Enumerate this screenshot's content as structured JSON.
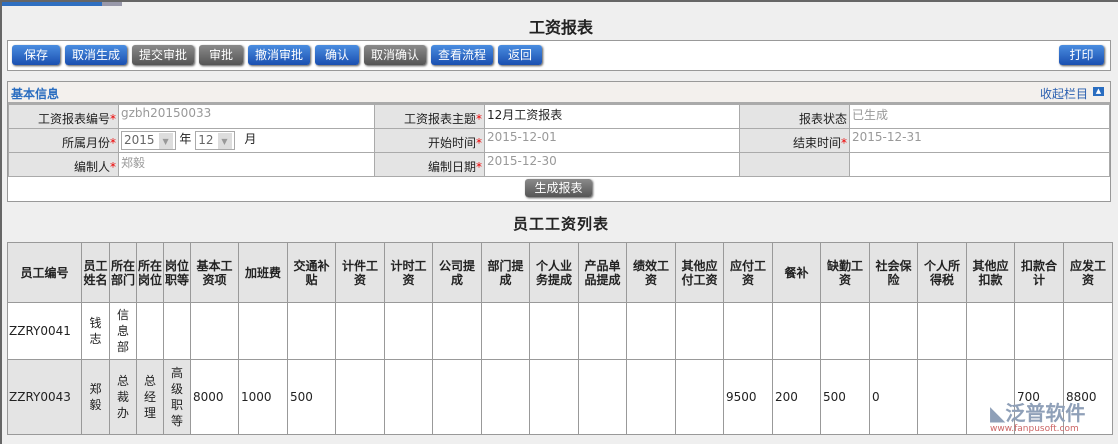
{
  "title": "工资报表",
  "toolbar": {
    "buttons": [
      {
        "label": "保存",
        "style": "blue"
      },
      {
        "label": "取消生成",
        "style": "blue"
      },
      {
        "label": "提交审批",
        "style": "gray"
      },
      {
        "label": "审批",
        "style": "gray"
      },
      {
        "label": "撤消审批",
        "style": "blue"
      },
      {
        "label": "确认",
        "style": "blue"
      },
      {
        "label": "取消确认",
        "style": "gray"
      },
      {
        "label": "查看流程",
        "style": "blue"
      },
      {
        "label": "返回",
        "style": "blue"
      }
    ],
    "print": "打印"
  },
  "basic": {
    "title": "基本信息",
    "collapse": "收起栏目",
    "report_no_label": "工资报表编号",
    "report_no": "gzbh20150033",
    "subject_label": "工资报表主题",
    "subject": "12月工资报表",
    "status_label": "报表状态",
    "status": "已生成",
    "month_label": "所属月份",
    "year": "2015",
    "year_unit": "年",
    "month": "12",
    "month_unit": "月",
    "start_label": "开始时间",
    "start": "2015-12-01",
    "end_label": "结束时间",
    "end": "2015-12-31",
    "author_label": "编制人",
    "author": "郑毅",
    "date_label": "编制日期",
    "date": "2015-12-30",
    "generate": "生成报表"
  },
  "list": {
    "title": "员工工资列表",
    "headers": [
      "员工编号",
      "员工姓名",
      "所在部门",
      "所在岗位",
      "岗位职等",
      "基本工资项",
      "加班费",
      "交通补贴",
      "计件工资",
      "计时工资",
      "公司提成",
      "部门提成",
      "个人业务提成",
      "产品单品提成",
      "绩效工资",
      "其他应付工资",
      "应付工资",
      "餐补",
      "缺勤工资",
      "社会保险",
      "个人所得税",
      "其他应扣款",
      "扣款合计",
      "应发工资"
    ],
    "rows": [
      [
        "ZZRY0041",
        "钱志",
        "信息部",
        "",
        "",
        "",
        "",
        "",
        "",
        "",
        "",
        "",
        "",
        "",
        "",
        "",
        "",
        "",
        "",
        "",
        "",
        "",
        "",
        ""
      ],
      [
        "ZZRY0043",
        "郑毅",
        "总裁办",
        "总经理",
        "高级职等",
        "8000",
        "1000",
        "500",
        "",
        "",
        "",
        "",
        "",
        "",
        "",
        "",
        "9500",
        "200",
        "500",
        "0",
        "",
        "",
        "700",
        "8800"
      ]
    ]
  },
  "watermark": {
    "name": "泛普软件",
    "url": "www.fanpusoft.com"
  }
}
